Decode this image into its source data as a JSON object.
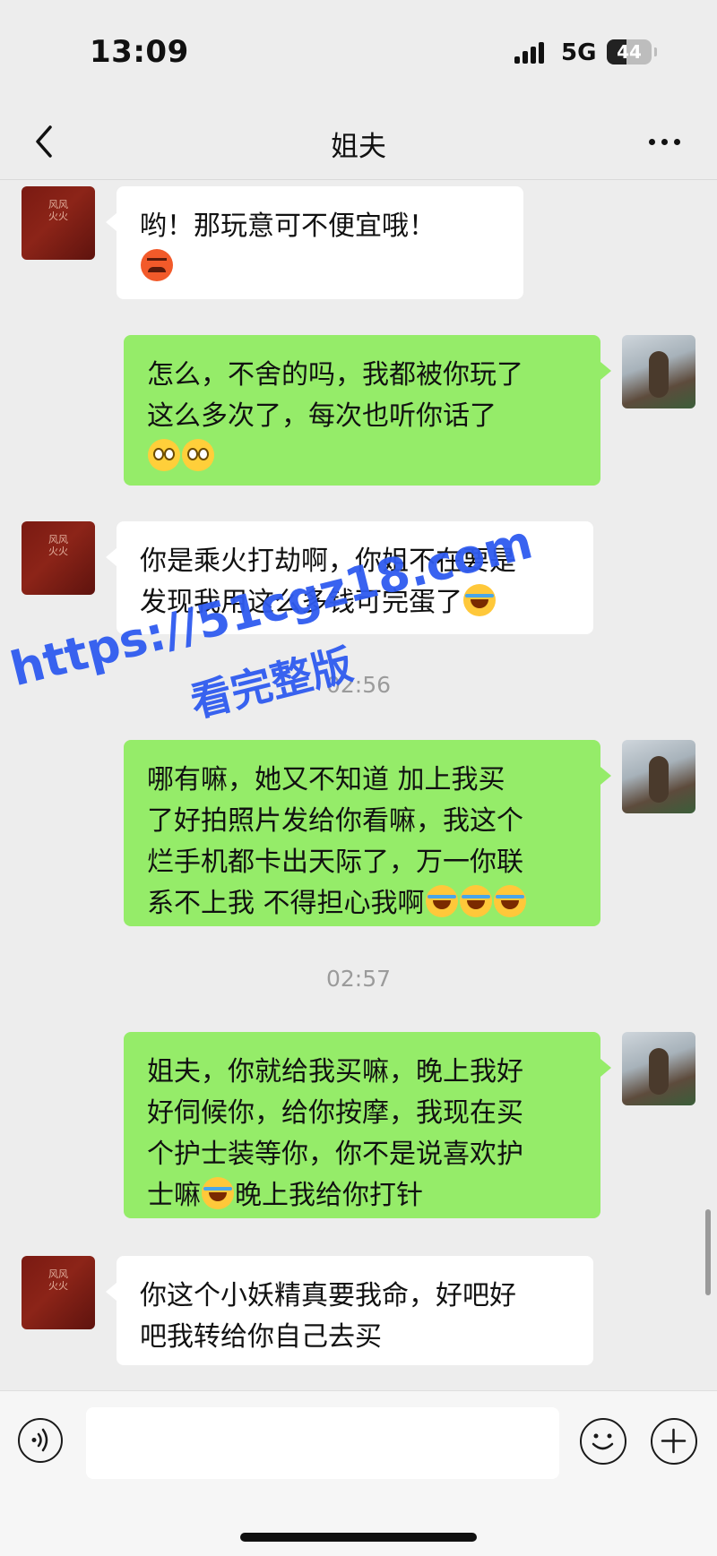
{
  "status_bar": {
    "time": "13:09",
    "network": "5G",
    "battery": "44",
    "battery_level": 0.44
  },
  "header": {
    "title": "姐夫"
  },
  "avatars": {
    "contact_text": "风风火火"
  },
  "messages": [
    {
      "side": "in",
      "text": "哟！那玩意可不便宜哦！",
      "emoji": "angry-face"
    },
    {
      "side": "out",
      "line1": "怎么，不舍的吗，我都被你玩了",
      "line2": "这么多次了，每次也听你话了",
      "emoji": "smile-face"
    },
    {
      "side": "in",
      "line1": "你是乘火打劫啊，你姐不在要是",
      "line2": "发现我用这么多钱可完蛋了",
      "emoji": "laugh-cry-face"
    },
    {
      "timestamp": "02:56"
    },
    {
      "side": "out",
      "line1": "哪有嘛，她又不知道 加上我买",
      "line2": "了好拍照片发给你看嘛，我这个",
      "line3": "烂手机都卡出天际了，万一你联",
      "line4": "系不上我 不得担心我啊",
      "emoji": "laugh-cry-face"
    },
    {
      "timestamp": "02:57"
    },
    {
      "side": "out",
      "line1": "姐夫，你就给我买嘛，晚上我好",
      "line2": "好伺候你，给你按摩，我现在买",
      "line3": "个护士装等你，你不是说喜欢护",
      "line4a": "士嘛",
      "line4b": "晚上我给你打针",
      "emoji": "laugh-cry-face"
    },
    {
      "side": "in",
      "line1": "你这个小妖精真要我命，好吧好",
      "line2": "吧我转给你自己去买"
    }
  ],
  "watermark": {
    "url": "https://51cgz18.com",
    "caption": "看完整版"
  },
  "input_bar": {
    "voice_icon": "voice-icon",
    "emoji_icon": "emoji-icon",
    "plus_icon": "plus-icon"
  }
}
